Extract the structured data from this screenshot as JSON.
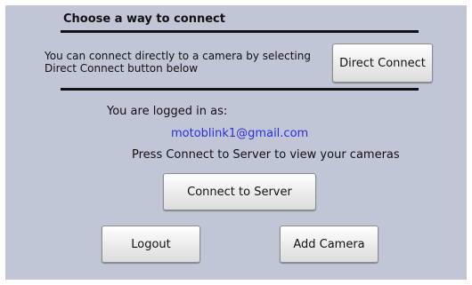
{
  "header": {
    "title": "Choose a way to connect"
  },
  "direct": {
    "description": "You can connect directly to a camera by selecting Direct Connect button below",
    "button_label": "Direct Connect"
  },
  "account": {
    "logged_in_label": "You are logged in as:",
    "email": "motoblink1@gmail.com",
    "instruction": "Press Connect to Server to view your cameras"
  },
  "actions": {
    "connect_server_label": "Connect to Server",
    "logout_label": "Logout",
    "add_camera_label": "Add Camera"
  },
  "colors": {
    "background": "#c1c6d6",
    "email_link": "#2a2fdb"
  }
}
